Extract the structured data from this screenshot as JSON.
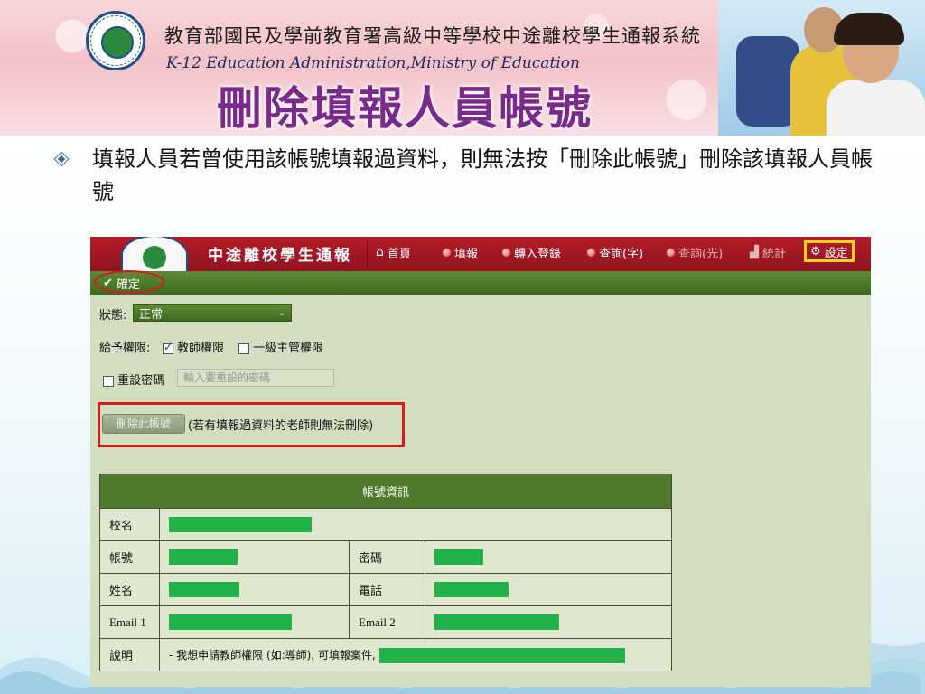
{
  "banner": {
    "cn_title": "教育部國民及學前教育署高級中等學校中途離校學生通報系統",
    "en_title": "K-12 Education Administration,Ministry of Education",
    "slide_title": "刪除填報人員帳號",
    "seal_icon": "ministry-of-education-seal"
  },
  "slide": {
    "instruction": "填報人員若曾使用該帳號填報過資料，則無法按「刪除此帳號」刪除該填報人員帳號"
  },
  "app": {
    "name": "中途離校學生通報",
    "nav": [
      {
        "label": "首頁",
        "icon": "home-icon"
      },
      {
        "label": "填報",
        "icon": "dot-icon"
      },
      {
        "label": "轉入登錄",
        "icon": "dot-icon"
      },
      {
        "label": "查詢(字)",
        "icon": "dot-icon"
      },
      {
        "label": "查詢(光)",
        "icon": "dot-icon"
      },
      {
        "label": "統計",
        "icon": "chart-icon"
      },
      {
        "label": "設定",
        "icon": "settings-icon"
      }
    ],
    "confirm_label": "確定",
    "status_label": "狀態:",
    "status_value": "正常",
    "grant_label": "給予權限:",
    "teacher_perm": "教師權限",
    "admin_perm": "一級主管權限",
    "reset_pw_label": "重設密碼",
    "reset_pw_placeholder": "輸入要重設的密碼",
    "delete_button": "刪除此帳號",
    "delete_note": "(若有填報過資料的老師則無法刪除)",
    "table": {
      "header": "帳號資訊",
      "school": "校名",
      "account": "帳號",
      "password": "密碼",
      "name": "姓名",
      "phone": "電話",
      "email1": "Email 1",
      "email2": "Email 2",
      "desc": "說明",
      "desc_value": "- 我想申請教師權限 (如:導師), 可填報案件,"
    }
  },
  "colors": {
    "app_bar": "#a3182a",
    "toolbar": "#4f7a2b",
    "redaction": "#21b24a",
    "highlight_red": "#d8191f",
    "highlight_yellow": "#f2d61c"
  }
}
